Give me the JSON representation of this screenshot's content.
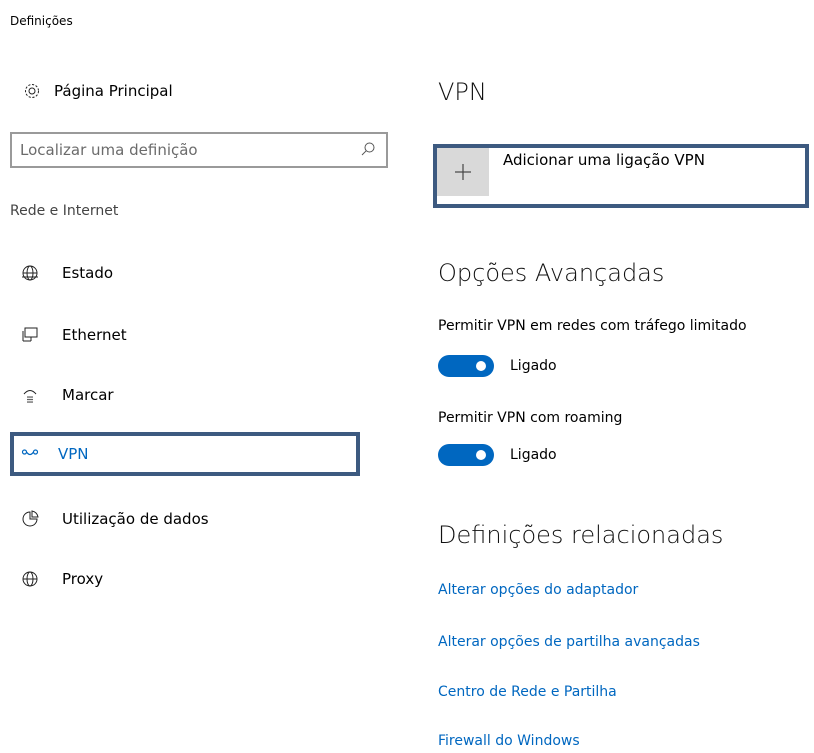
{
  "window": {
    "title": "Definições"
  },
  "sidebar": {
    "home_label": "Página Principal",
    "search": {
      "placeholder": "Localizar uma definição"
    },
    "section": "Rede e Internet",
    "items": [
      {
        "label": "Estado",
        "icon": "globe-status-icon"
      },
      {
        "label": "Ethernet",
        "icon": "ethernet-icon"
      },
      {
        "label": "Marcar",
        "icon": "dialup-icon"
      },
      {
        "label": "VPN",
        "icon": "vpn-icon",
        "selected": true
      },
      {
        "label": "Utilização de dados",
        "icon": "data-usage-icon"
      },
      {
        "label": "Proxy",
        "icon": "globe-icon"
      }
    ]
  },
  "main": {
    "title": "VPN",
    "add_vpn_label": "Adicionar uma ligação VPN",
    "advanced": {
      "title": "Opções Avançadas",
      "options": [
        {
          "label": "Permitir VPN em redes com tráfego limitado",
          "state": "Ligado",
          "on": true
        },
        {
          "label": "Permitir VPN com roaming",
          "state": "Ligado",
          "on": true
        }
      ]
    },
    "related": {
      "title": "Definições relacionadas",
      "links": [
        "Alterar opções do adaptador",
        "Alterar opções de partilha avançadas",
        "Centro de Rede e Partilha",
        "Firewall do Windows"
      ]
    }
  },
  "colors": {
    "accent": "#0067c0",
    "highlight_border": "#3d5a80",
    "tile": "#d9d9d9"
  }
}
